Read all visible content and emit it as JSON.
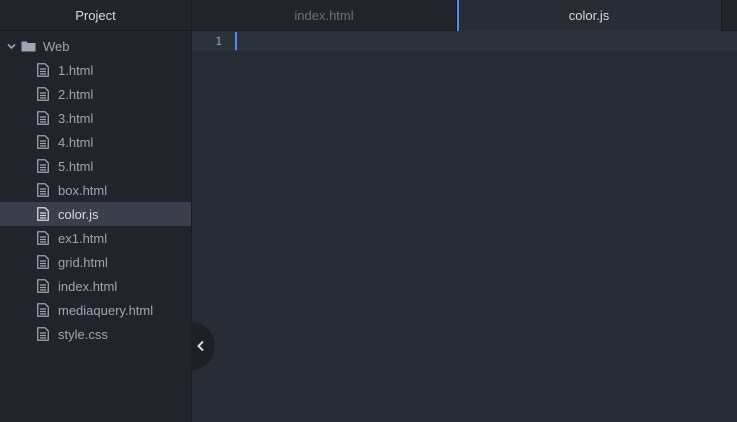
{
  "sidebar": {
    "title": "Project",
    "root": {
      "name": "Web",
      "expanded_icon": "chevron-down-icon",
      "folder_icon": "folder-icon"
    },
    "files": [
      {
        "name": "1.html"
      },
      {
        "name": "2.html"
      },
      {
        "name": "3.html"
      },
      {
        "name": "4.html"
      },
      {
        "name": "5.html"
      },
      {
        "name": "box.html"
      },
      {
        "name": "color.js",
        "selected": true
      },
      {
        "name": "ex1.html"
      },
      {
        "name": "grid.html"
      },
      {
        "name": "index.html"
      },
      {
        "name": "mediaquery.html"
      },
      {
        "name": "style.css"
      }
    ],
    "collapse_icon": "chevron-left-icon"
  },
  "tabs": [
    {
      "label": "index.html",
      "active": false
    },
    {
      "label": "color.js",
      "active": true
    }
  ],
  "editor": {
    "lines": [
      "1"
    ]
  },
  "colors": {
    "sidebar_bg": "#21252b",
    "editor_bg": "#282c34",
    "accent": "#568af2",
    "selected_bg": "#3a3f4b"
  }
}
